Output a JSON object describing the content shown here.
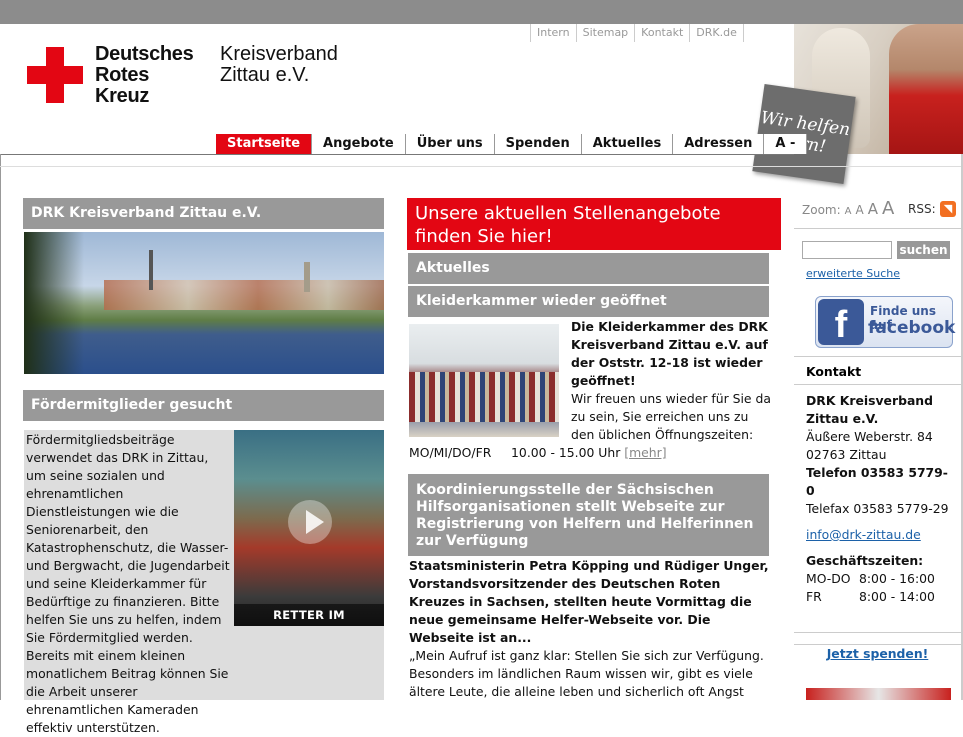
{
  "header": {
    "util_nav": [
      "Intern",
      "Sitemap",
      "Kontakt",
      "DRK.de"
    ],
    "logo_lines": [
      "Deutsches",
      "Rotes",
      "Kreuz"
    ],
    "org_name_line1": "Kreisverband",
    "org_name_line2": "Zittau e.V.",
    "badge_line1": "Wir helfen",
    "badge_line2": "gern!"
  },
  "main_nav": {
    "items": [
      "Startseite",
      "Angebote",
      "Über uns",
      "Spenden",
      "Aktuelles",
      "Adressen",
      "A -"
    ],
    "active": "Startseite"
  },
  "left": {
    "box1_title": "DRK Kreisverband Zittau e.V.",
    "box2_title": "Fördermitglieder gesucht",
    "promo_text": "Fördermitgliedsbeiträge verwendet das DRK in Zittau, um seine sozialen und ehrenamtlichen Dienstleistungen wie die Seniorenarbeit, den Katastrophenschutz, die Wasser- und Bergwacht, die Jugendarbeit und seine Kleiderkammer für Bedürftige zu finanzieren. Bitte helfen Sie uns zu helfen, indem Sie Fördermitglied werden. Bereits mit einem kleinen monatlichem Beitrag können Sie die Arbeit unserer ehrenamtlichen Kameraden effektiv unterstützen.",
    "video_caption": "RETTER IM EHRENAMT"
  },
  "center": {
    "stellen_banner": "Unsere aktuellen Stellenangebote finden Sie hier!",
    "aktuelles_title": "Aktuelles",
    "article1": {
      "title": "Kleiderkammer wieder geöffnet",
      "lead": "Die Kleiderkammer des DRK Kreisverband Zittau e.V. auf der Oststr. 12-18 ist wieder geöffnet!",
      "body": "Wir freuen uns wieder für Sie da zu sein, Sie erreichen uns zu den üblichen Öffnungszeiten:",
      "hours_days": "MO/MI/DO/FR",
      "hours_time": "10.00 - 15.00 Uhr",
      "more": "[mehr]"
    },
    "article2": {
      "title": "Koordinierungsstelle der Sächsischen Hilfsorganisationen stellt Webseite zur Registrierung von Helfern und Helferinnen zur Verfügung",
      "lead": "Staatsministerin Petra Köpping und Rüdiger Unger, Vorstandsvorsitzender des Deutschen Roten Kreuzes in Sachsen, stellten heute Vormittag die neue gemeinsame Helfer-Webseite vor. Die Webseite ist an...",
      "body": "„Mein Aufruf ist ganz klar: Stellen Sie sich zur Verfügung. Besonders im ländlichen Raum wissen wir, gibt es viele ältere Leute, die alleine leben und sicherlich oft Angst"
    }
  },
  "right": {
    "zoom_label": "Zoom:",
    "zoom_sizes": [
      "A",
      "A",
      "A",
      "A"
    ],
    "rss_label": "RSS:",
    "rss_icon": "rss-icon",
    "search_value": "",
    "search_button": "suchen",
    "advanced_search": "erweiterte Suche",
    "fb_line1": "Finde uns auf",
    "fb_line2": "facebook",
    "contact_title": "Kontakt",
    "contact_name": "DRK Kreisverband Zittau e.V.",
    "contact_street": "Äußere Weberstr. 84",
    "contact_city": "02763 Zittau",
    "contact_phone": "Telefon 03583 5779-0",
    "contact_fax": "Telefax 03583 5779-29",
    "contact_email": "info@drk-zittau.de",
    "hours_title": "Geschäftszeiten:",
    "hours": [
      {
        "days": "MO-DO",
        "time": "8:00 - 16:00"
      },
      {
        "days": "FR",
        "time": "8:00 - 14:00"
      }
    ],
    "donate": "Jetzt spenden!"
  },
  "colors": {
    "drk_red": "#e30613",
    "panel_gray": "#999999",
    "link_blue": "#1c61a8"
  }
}
